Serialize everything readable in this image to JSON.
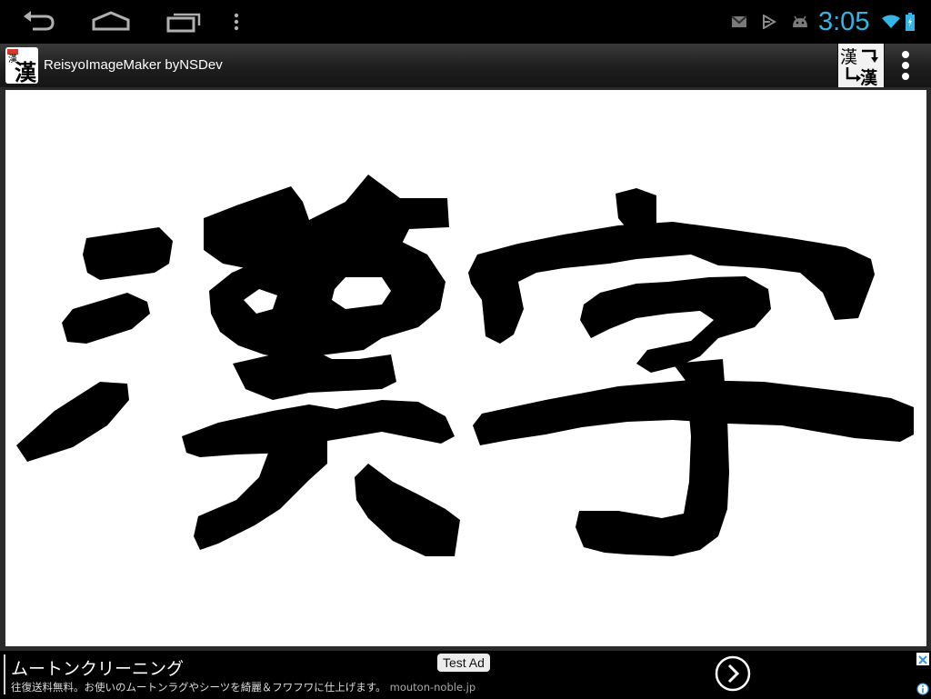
{
  "status_bar": {
    "time": "3:05",
    "time_color": "#33b5e5",
    "nav_icons": [
      "back-icon",
      "home-icon",
      "recent-apps-icon",
      "menu-icon"
    ],
    "status_icons": [
      "gmail-icon",
      "play-store-icon",
      "android-icon",
      "wifi-icon",
      "battery-icon"
    ]
  },
  "action_bar": {
    "app_title": "ReisyoImageMaker byNSDev",
    "app_icon_text": "漢",
    "convert_button_glyphs": [
      "漢",
      "漢"
    ],
    "overflow_icon": "overflow-menu-icon"
  },
  "canvas": {
    "text": "漢字",
    "text_color": "#000000",
    "background": "#ffffff"
  },
  "ad": {
    "title": "ムートンクリーニング",
    "body": "往復送料無料。お使いのムートンラグやシーツを綺麗＆フワフワに仕上げます。",
    "domain": "mouton-noble.jp",
    "badge": "Test Ad",
    "icons": [
      "arrow-right-icon",
      "close-icon",
      "info-icon"
    ]
  }
}
